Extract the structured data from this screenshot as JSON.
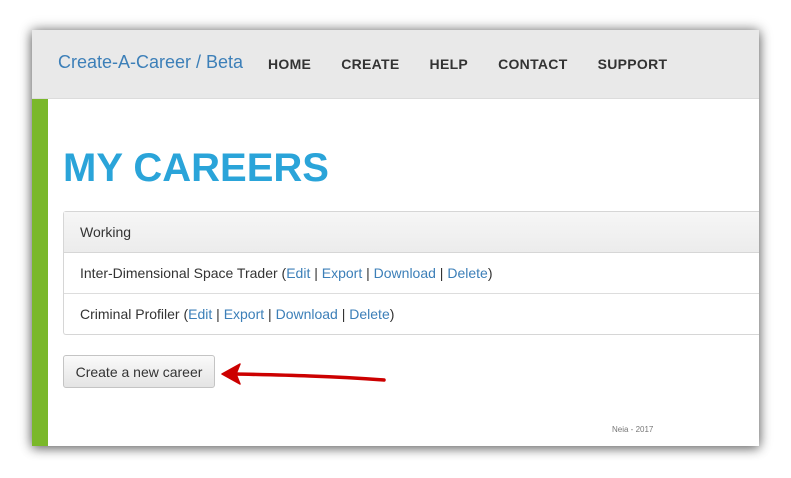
{
  "brand": "Create-A-Career / Beta",
  "nav": [
    "HOME",
    "CREATE",
    "HELP",
    "CONTACT",
    "SUPPORT"
  ],
  "page_title": "MY CAREERS",
  "panel": {
    "header": "Working",
    "rows": [
      {
        "name": "Inter-Dimensional Space Trader",
        "actions": [
          "Edit",
          "Export",
          "Download",
          "Delete"
        ]
      },
      {
        "name": "Criminal Profiler",
        "actions": [
          "Edit",
          "Export",
          "Download",
          "Delete"
        ]
      }
    ]
  },
  "create_button": "Create a new career",
  "footer": "Neia - 2017",
  "colors": {
    "brand_link": "#3c7fb8",
    "title": "#2aa4d9",
    "accent_bar": "#7ab82a",
    "annotation_arrow": "#cc0000"
  }
}
